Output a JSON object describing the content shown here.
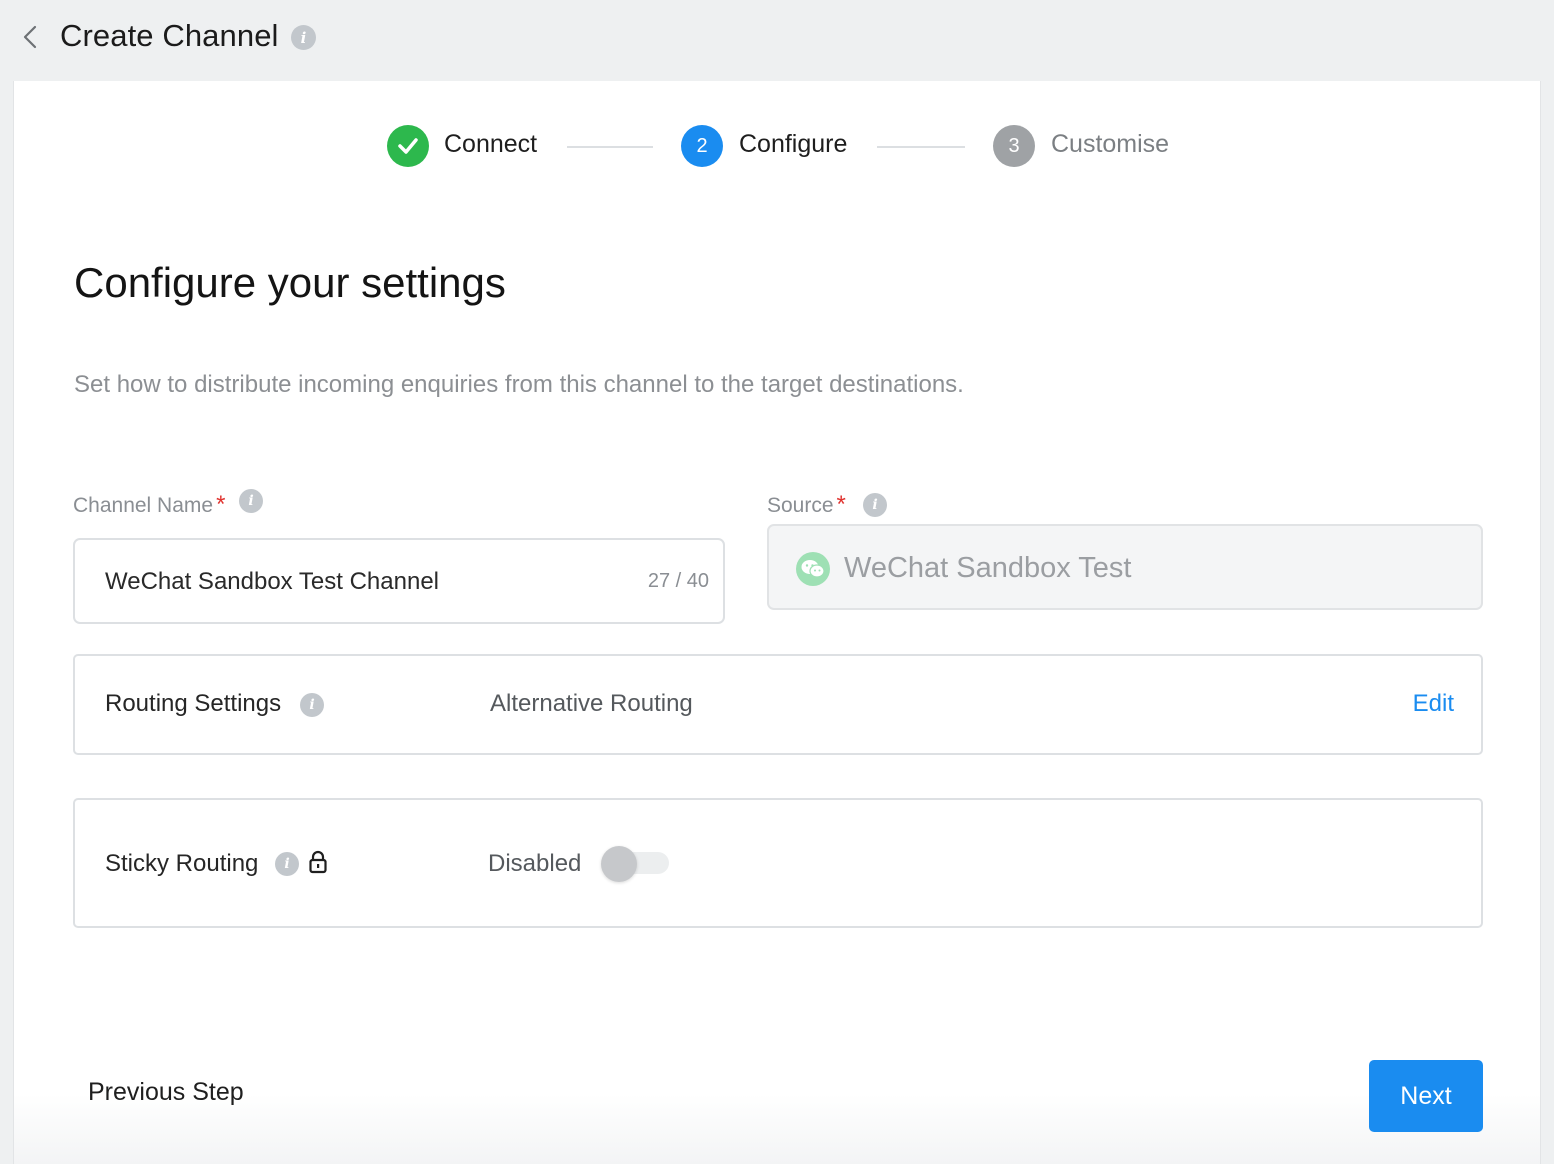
{
  "header": {
    "title": "Create Channel"
  },
  "stepper": {
    "steps": [
      {
        "number": "",
        "label": "Connect",
        "state": "done"
      },
      {
        "number": "2",
        "label": "Configure",
        "state": "active"
      },
      {
        "number": "3",
        "label": "Customise",
        "state": "pending"
      }
    ]
  },
  "main": {
    "title": "Configure your settings",
    "description": "Set how to distribute incoming enquiries from this channel to the target destinations."
  },
  "form": {
    "channel_name": {
      "label": "Channel Name",
      "required_mark": "*",
      "value": "WeChat Sandbox Test Channel",
      "counter": "27 / 40"
    },
    "source": {
      "label": "Source",
      "required_mark": "*",
      "value": "WeChat Sandbox Test"
    },
    "routing": {
      "label": "Routing Settings",
      "value": "Alternative Routing",
      "edit_label": "Edit"
    },
    "sticky": {
      "label": "Sticky Routing",
      "value": "Disabled",
      "enabled": false
    }
  },
  "footer": {
    "previous_label": "Previous Step",
    "next_label": "Next"
  },
  "colors": {
    "accent": "#1a8cf0",
    "success": "#2db84d",
    "required": "#e0332f"
  }
}
